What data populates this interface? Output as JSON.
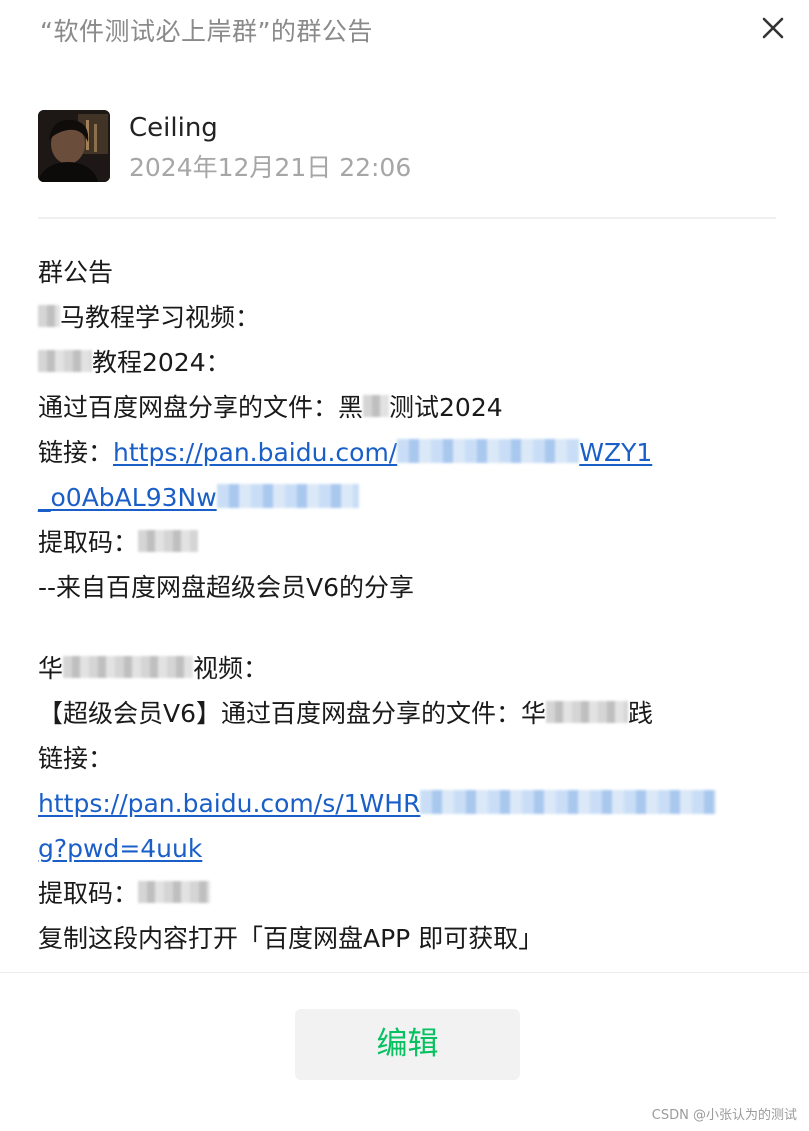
{
  "dialog": {
    "title": "“软件测试必上岸群”的群公告",
    "close_icon": "close-icon"
  },
  "author": {
    "name": "Ceiling",
    "timestamp": "2024年12月21日 22:06",
    "avatar_icon": "avatar-photo"
  },
  "announcement": {
    "heading": "群公告",
    "section1": {
      "line1": "马教程学习视频：",
      "line2_tail": "教程2024：",
      "line3": "通过百度网盘分享的文件：黑",
      "line3_tail": "测试2024",
      "link_label": "链接：",
      "link_part1": "https://pan.baidu.com/",
      "link_part1_tail": "WZY1",
      "link_part2": "_o0AbAL93Nw",
      "code_label": "提取码：",
      "footer": "--来自百度网盘超级会员V6的分享"
    },
    "section2": {
      "line1_head": "华",
      "line1_tail": "视频：",
      "line2": "【超级会员V6】通过百度网盘分享的文件：华",
      "line2_tail": "践",
      "link_label": "链接：",
      "link_part1": "https://pan.baidu.com/s/1WHR",
      "link_part2": "g?pwd=4uuk",
      "code_label": "提取码：",
      "footer": "复制这段内容打开「百度网盘APP 即可获取」"
    }
  },
  "actions": {
    "edit_label": "编辑"
  },
  "watermark": "CSDN @小张认为的测试",
  "colors": {
    "accent_green": "#07c160",
    "link_blue": "#1a5fc8",
    "title_gray": "#8a8a8a"
  }
}
